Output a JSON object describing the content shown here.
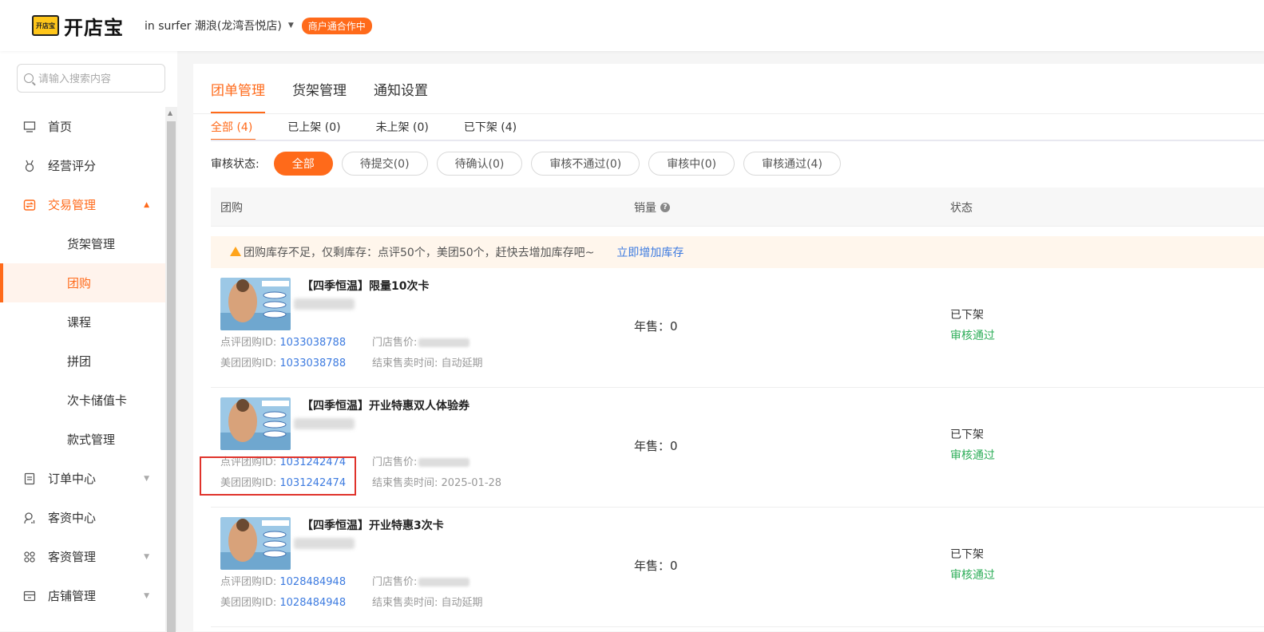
{
  "header": {
    "logo_box": "开店宝",
    "logo_text": "开店宝",
    "store_name": "in surfer 潮浪(龙湾吾悦店)",
    "coop_badge": "商户通合作中"
  },
  "sidebar": {
    "search_placeholder": "请输入搜索内容",
    "items": [
      {
        "label": "首页",
        "icon": "monitor-icon"
      },
      {
        "label": "经营评分",
        "icon": "medal-icon"
      },
      {
        "label": "交易管理",
        "icon": "trade-icon",
        "expanded": true
      },
      {
        "label": "订单中心",
        "icon": "order-icon"
      },
      {
        "label": "客资中心",
        "icon": "customer-icon"
      },
      {
        "label": "客资管理",
        "icon": "grid-icon"
      },
      {
        "label": "店铺管理",
        "icon": "store-icon"
      }
    ],
    "sub_items": [
      "货架管理",
      "团购",
      "课程",
      "拼团",
      "次卡储值卡",
      "款式管理"
    ],
    "selected_sub": "团购"
  },
  "main": {
    "tabs": [
      "团单管理",
      "货架管理",
      "通知设置"
    ],
    "subtabs": [
      "全部 (4)",
      "已上架 (0)",
      "未上架 (0)",
      "已下架 (4)"
    ],
    "review_label": "审核状态:",
    "review_pills": [
      "全部",
      "待提交(0)",
      "待确认(0)",
      "审核不通过(0)",
      "审核中(0)",
      "审核通过(4)"
    ],
    "table_headers": {
      "group": "团购",
      "sales": "销量",
      "status": "状态"
    },
    "warning": {
      "text": "团购库存不足，仅剩库存：点评50个，美团50个，赶快去增加库存吧~",
      "link": "立即增加库存"
    },
    "rows": [
      {
        "title": "【四季恒温】限量10次卡",
        "dp_label": "点评团购ID:",
        "dp_id": "1033038788",
        "mt_label": "美团团购ID:",
        "mt_id": "1033038788",
        "store_price_label": "门店售价:",
        "end_time": "结束售卖时间: 自动延期",
        "sales": "年售：0",
        "status": "已下架",
        "review": "审核通过"
      },
      {
        "title": "【四季恒温】开业特惠双人体验券",
        "dp_label": "点评团购ID:",
        "dp_id": "1031242474",
        "mt_label": "美团团购ID:",
        "mt_id": "1031242474",
        "store_price_label": "门店售价:",
        "end_time": "结束售卖时间: 2025-01-28",
        "sales": "年售：0",
        "status": "已下架",
        "review": "审核通过"
      },
      {
        "title": "【四季恒温】开业特惠3次卡",
        "dp_label": "点评团购ID:",
        "dp_id": "1028484948",
        "mt_label": "美团团购ID:",
        "mt_id": "1028484948",
        "store_price_label": "门店售价:",
        "end_time": "结束售卖时间: 自动延期",
        "sales": "年售：0",
        "status": "已下架",
        "review": "审核通过"
      }
    ]
  },
  "colors": {
    "accent": "#ff6a1a",
    "link": "#3d7be0",
    "success": "#2fae5a",
    "highlight": "#e0332b"
  }
}
